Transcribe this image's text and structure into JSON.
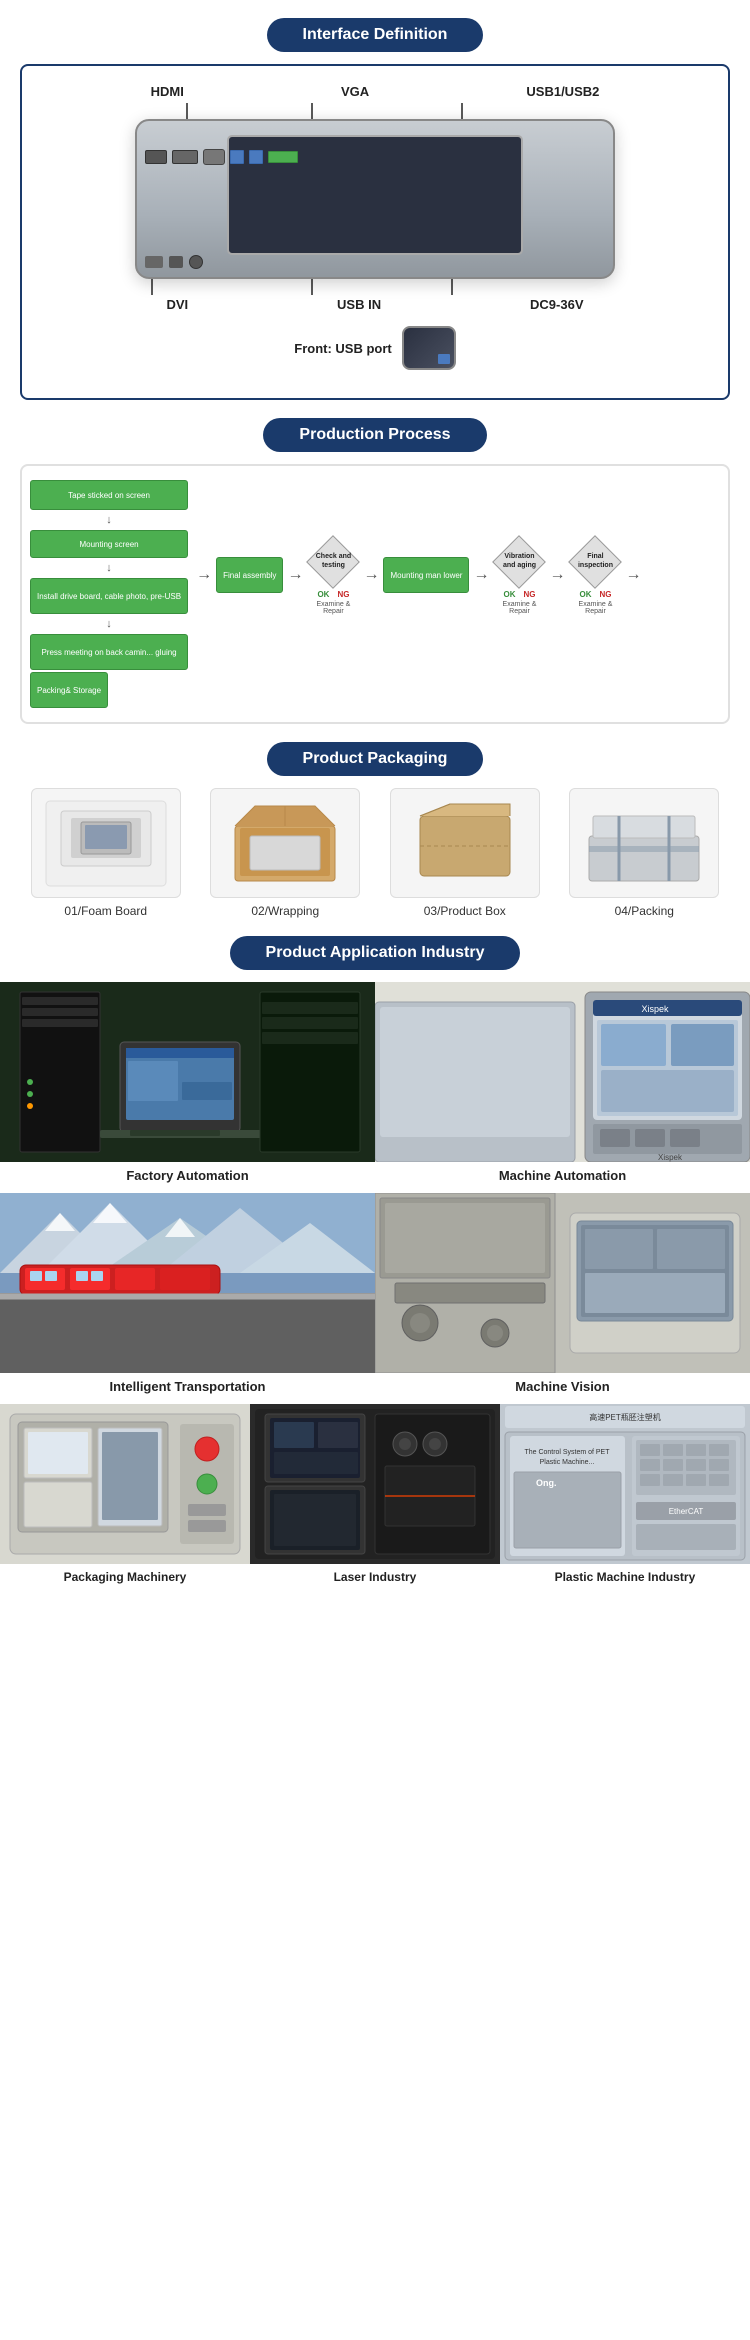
{
  "sections": {
    "interface": {
      "title": "Interface Definition",
      "labels": {
        "hdmi": "HDMI",
        "vga": "VGA",
        "usb12": "USB1/USB2",
        "dvi": "DVI",
        "usbin": "USB IN",
        "dc": "DC9-36V",
        "front": "Front: USB port"
      }
    },
    "production": {
      "title": "Production Process",
      "steps": [
        "Tape sticked on screen",
        "Mounting screen",
        "Install drive board, cable photo, pre-USB",
        "Press meeting on back camin... gluing",
        "Final assembly",
        "Check and testing",
        "Mounting man lower",
        "Vibration and aging",
        "Final inspection",
        "Packing& Storage"
      ],
      "decisions": [
        "Check and testing",
        "Vibration and aging",
        "Final inspection"
      ],
      "examine_repair": "Examine & Repair"
    },
    "packaging": {
      "title": "Product Packaging",
      "items": [
        {
          "label": "01/Foam Board"
        },
        {
          "label": "02/Wrapping"
        },
        {
          "label": "03/Product Box"
        },
        {
          "label": "04/Packing"
        }
      ]
    },
    "application": {
      "title": "Product Application Industry",
      "items": [
        {
          "label": "Factory Automation",
          "id": "factory"
        },
        {
          "label": "Machine Automation",
          "id": "machine"
        },
        {
          "label": "Intelligent Transportation",
          "id": "transport"
        },
        {
          "label": "Machine Vision",
          "id": "vision"
        },
        {
          "label": "Packaging Machinery",
          "id": "packaging"
        },
        {
          "label": "Laser Industry",
          "id": "laser"
        },
        {
          "label": "Plastic Machine Industry",
          "id": "plastic"
        }
      ]
    }
  }
}
